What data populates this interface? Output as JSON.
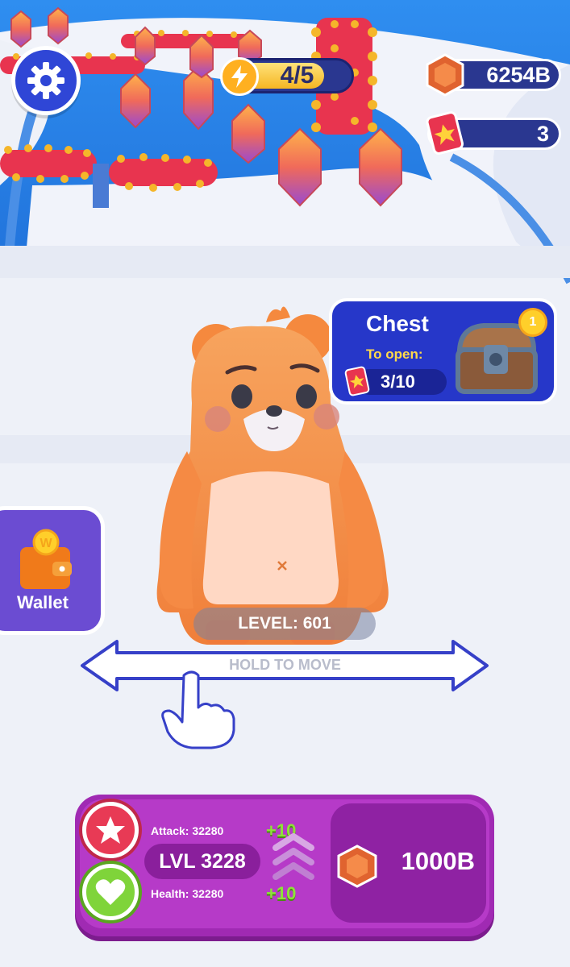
{
  "hud": {
    "energy": "4/5",
    "energy_fraction": 0.8,
    "gems": "6254B",
    "cards": "3"
  },
  "chest": {
    "title": "Chest",
    "subtitle": "To open:",
    "progress": "3/10",
    "coin_badge": "1"
  },
  "wallet": {
    "label": "Wallet",
    "coin_letter": "W"
  },
  "game": {
    "level": "LEVEL: 601",
    "hint": "HOLD TO MOVE"
  },
  "stats": {
    "attack": "Attack: 32280",
    "health": "Health: 32280",
    "lvl": "LVL 3228",
    "attack_bonus": "+10",
    "health_bonus": "+10",
    "upgrade_cost": "1000B"
  },
  "colors": {
    "accent_blue": "#2637c9",
    "panel_purple": "#b63ac8",
    "gem_orange": "#f07a3a",
    "bear_orange": "#f5893e"
  },
  "icons": {
    "settings": "gear-icon",
    "energy": "lightning-icon",
    "gem": "gem-icon",
    "card": "star-card-icon",
    "chest": "chest-icon",
    "wallet": "wallet-icon",
    "attack": "star-icon",
    "health": "heart-icon",
    "hand": "pointer-hand-icon"
  }
}
